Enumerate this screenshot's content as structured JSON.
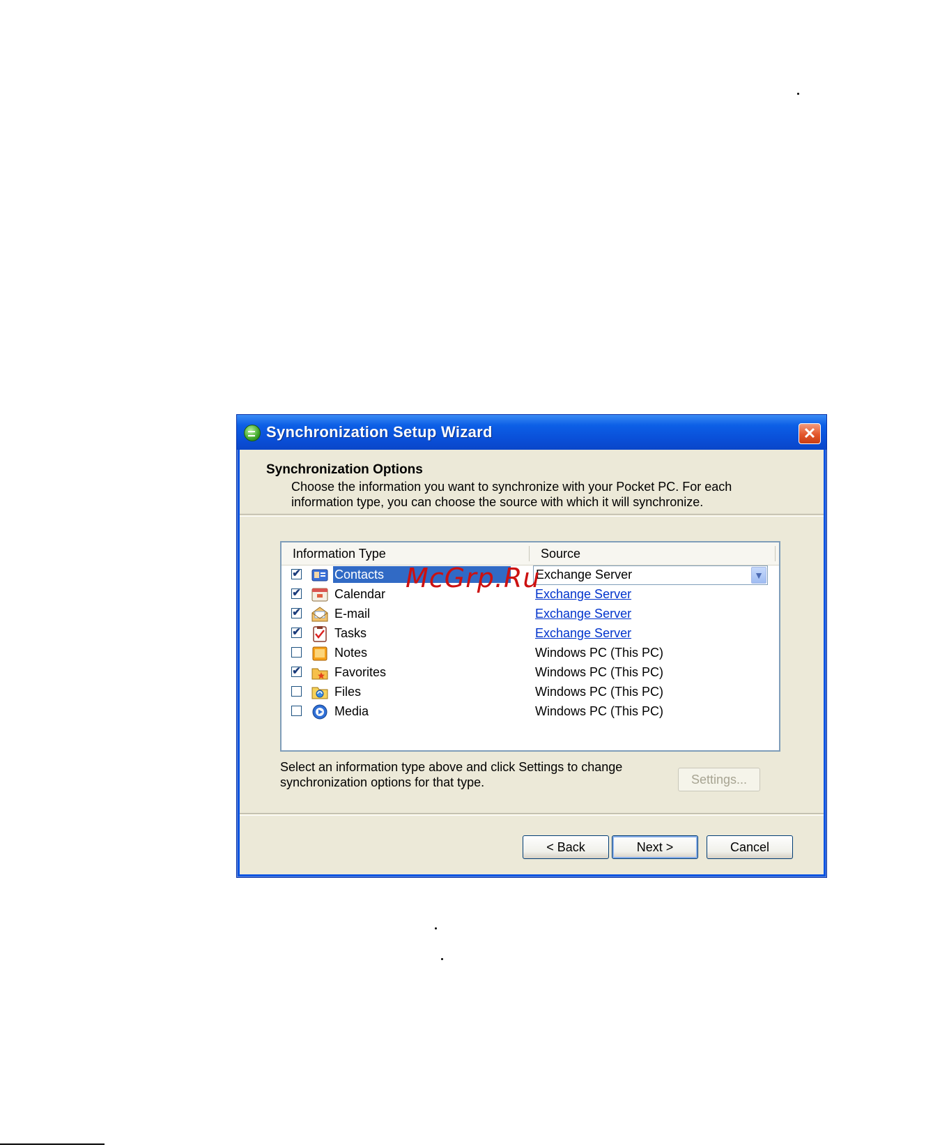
{
  "dialog": {
    "title": "Synchronization Setup Wizard",
    "close_symbol": "✕",
    "header_title": "Synchronization Options",
    "header_description": "Choose the information you want to synchronize with your Pocket PC.  For each information type, you can choose the source with which it will synchronize."
  },
  "list": {
    "columns": [
      "Information Type",
      "Source"
    ],
    "rows": [
      {
        "label": "Contacts",
        "checked": "✔",
        "source": "Exchange Server",
        "icon": "contacts-icon"
      },
      {
        "label": "Calendar",
        "checked": "✔",
        "source": "Exchange Server",
        "icon": "calendar-icon"
      },
      {
        "label": "E-mail",
        "checked": "✔",
        "source": "Exchange Server",
        "icon": "email-icon"
      },
      {
        "label": "Tasks",
        "checked": "✔",
        "source": "Exchange Server",
        "icon": "tasks-icon"
      },
      {
        "label": "Notes",
        "checked": "",
        "source": "Windows PC (This PC)",
        "icon": "notes-icon"
      },
      {
        "label": "Favorites",
        "checked": "✔",
        "source": "Windows PC (This PC)",
        "icon": "favorites-icon"
      },
      {
        "label": "Files",
        "checked": "",
        "source": "Windows PC (This PC)",
        "icon": "files-icon"
      },
      {
        "label": "Media",
        "checked": "",
        "source": "Windows PC (This PC)",
        "icon": "media-icon"
      }
    ],
    "selected_index": 0,
    "combo_arrow": "▼"
  },
  "hint": "Select an information type above and click Settings to change synchronization options for that type.",
  "buttons": {
    "settings": "Settings...",
    "back": "< Back",
    "next": "Next >",
    "cancel": "Cancel"
  },
  "watermark": "McGrp.Ru",
  "colors": {
    "titlebar": "#0a54e3",
    "selection": "#316ac5",
    "link": "#0033cc",
    "dialog_face": "#ece9d8"
  }
}
